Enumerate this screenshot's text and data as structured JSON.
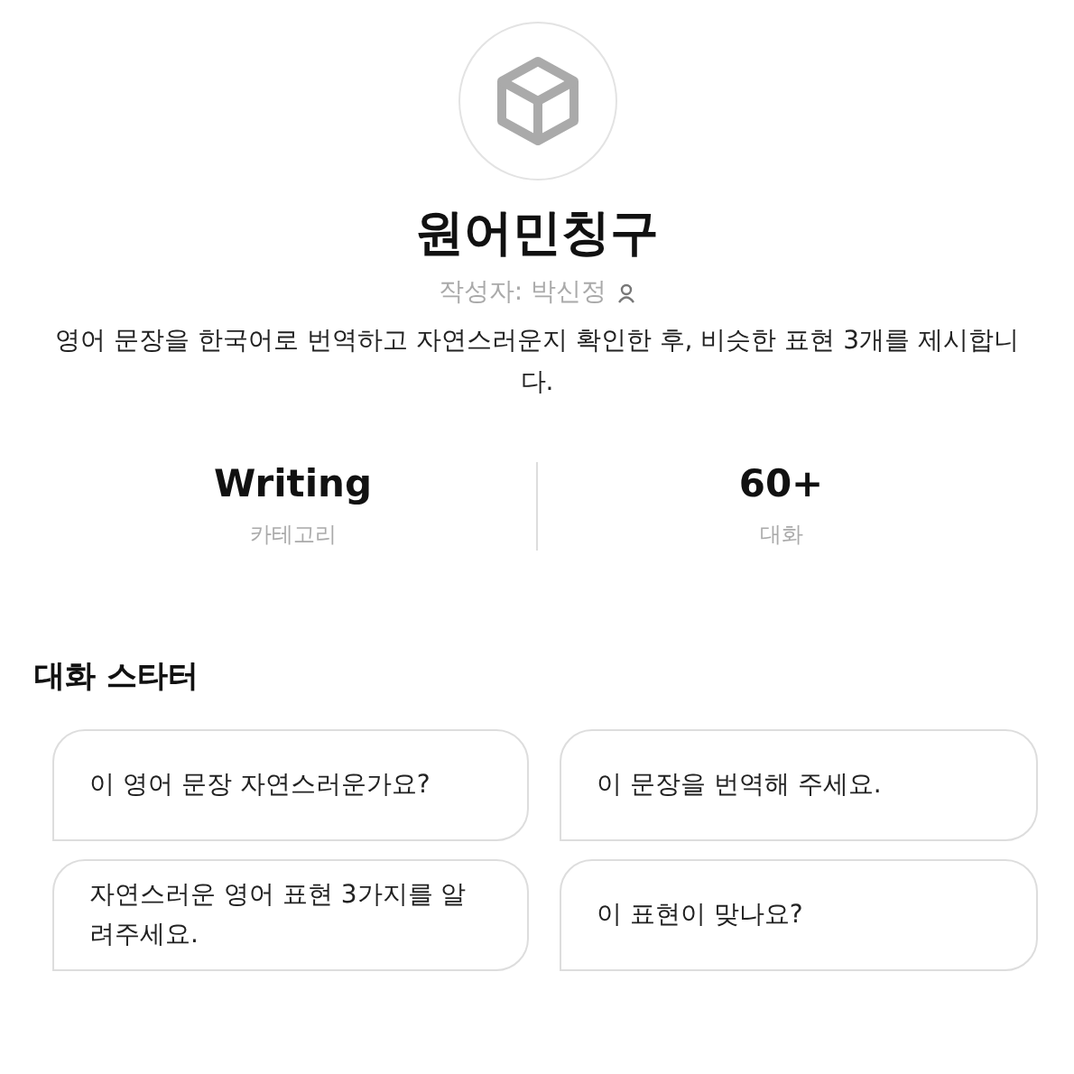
{
  "profile": {
    "name": "원어민칭구",
    "author": "작성자: 박신정",
    "description": "영어 문장을 한국어로 번역하고 자연스러운지 확인한 후, 비슷한 표현 3개를 제시합니다."
  },
  "stats": [
    {
      "value": "Writing",
      "label": "카테고리"
    },
    {
      "value": "60+",
      "label": "대화"
    }
  ],
  "starters": {
    "title": "대화 스타터",
    "items": [
      "이 영어 문장 자연스러운가요?",
      "이 문장을 번역해 주세요.",
      "자연스러운 영어 표현 3가지를 알려주세요.",
      "이 표현이 맞나요?"
    ]
  }
}
